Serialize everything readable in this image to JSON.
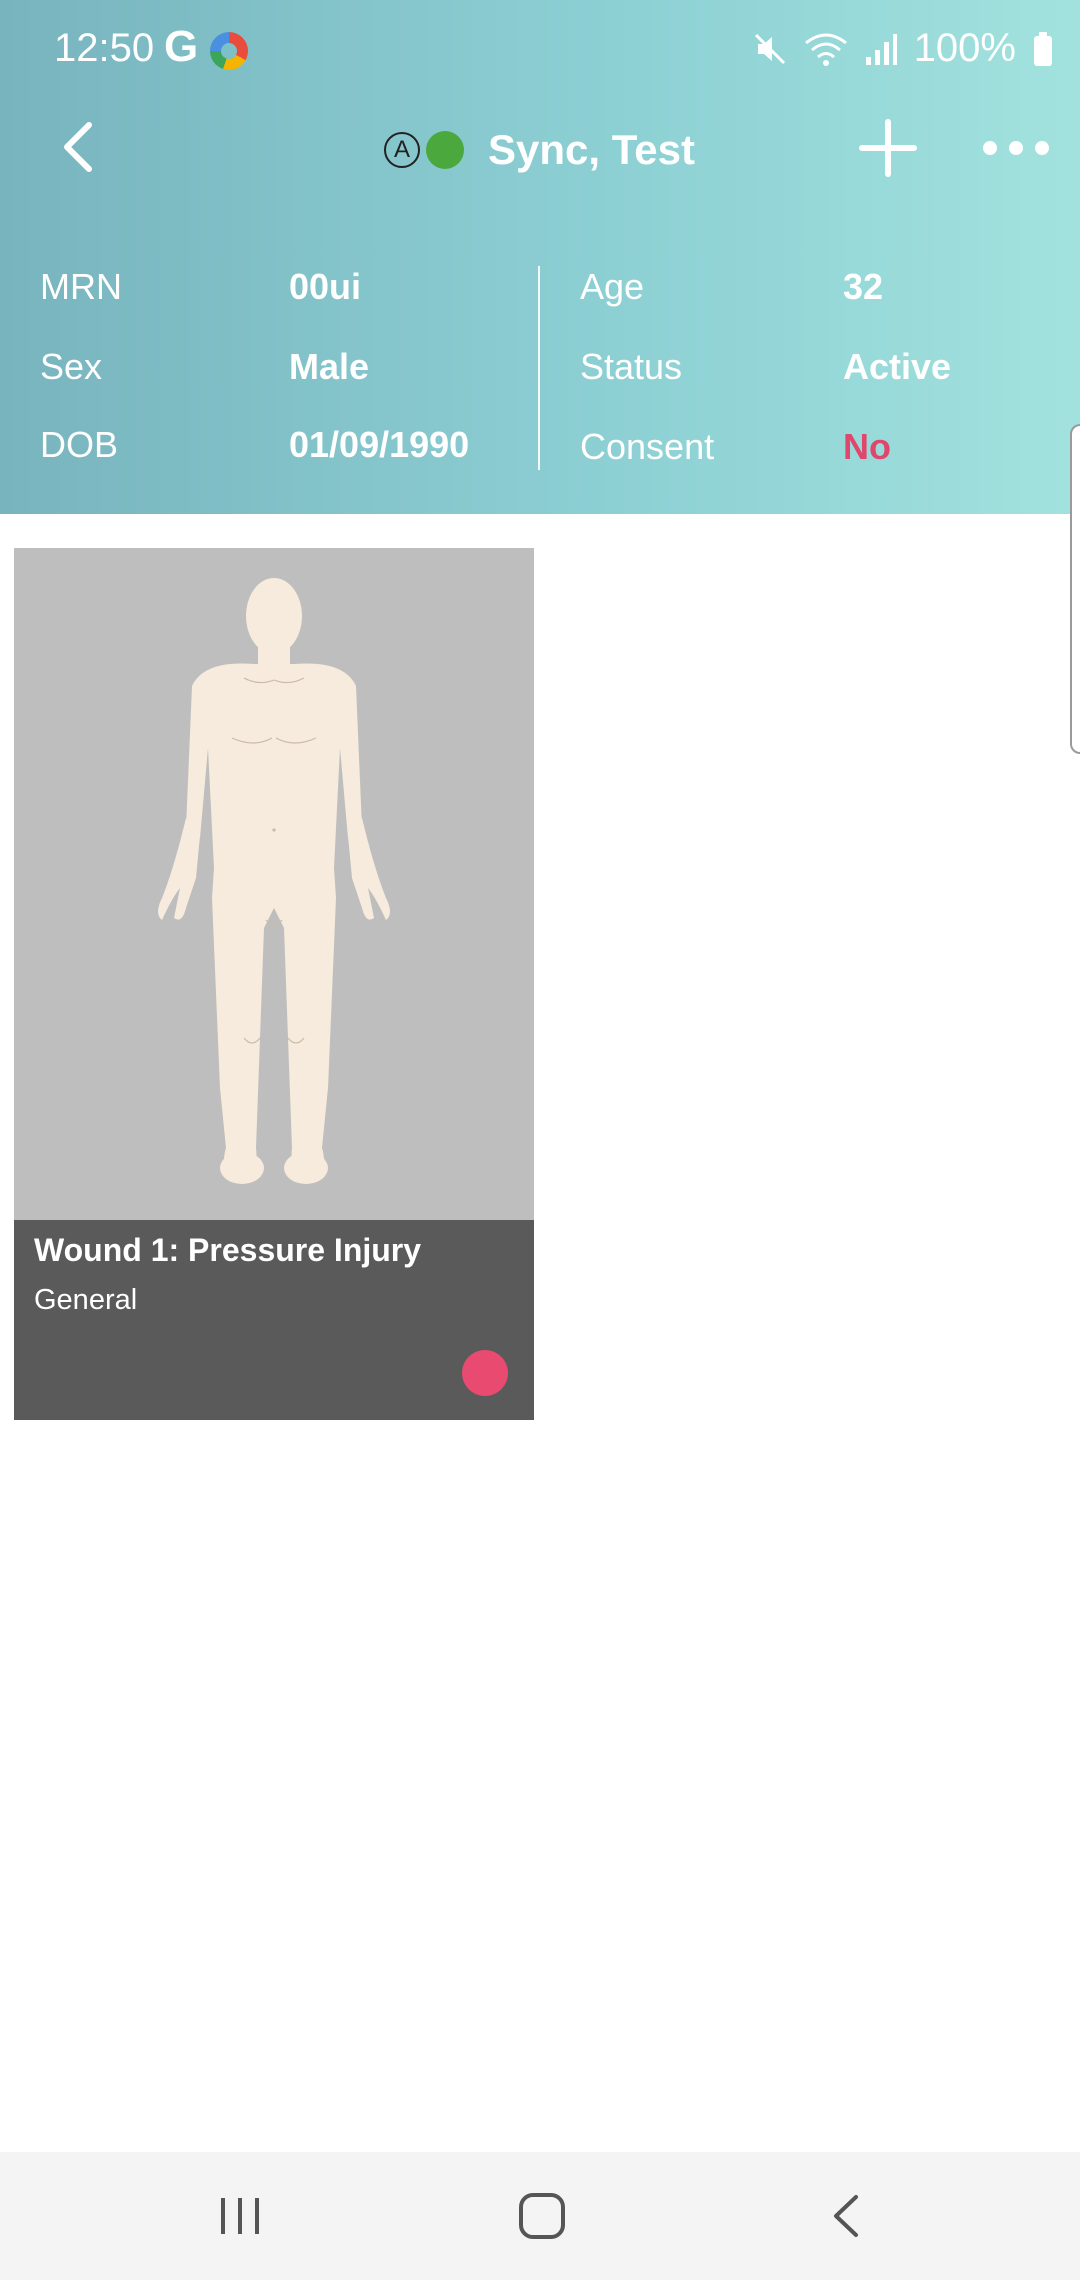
{
  "status_bar": {
    "time": "12:50",
    "g_label": "G",
    "battery": "100%",
    "icons": [
      "google-g-icon",
      "chrome-icon",
      "mute-icon",
      "wifi-icon",
      "signal-icon",
      "battery-icon"
    ]
  },
  "app_bar": {
    "title": "Sync, Test",
    "a_badge": "A",
    "status_color": "#4aa83c",
    "icons": [
      "back-icon",
      "add-icon",
      "more-icon"
    ]
  },
  "patient": {
    "left": [
      {
        "label": "MRN",
        "value": "00ui"
      },
      {
        "label": "Sex",
        "value": "Male"
      },
      {
        "label": "DOB",
        "value": "01/09/1990"
      }
    ],
    "right": [
      {
        "label": "Age",
        "value": "32"
      },
      {
        "label": "Status",
        "value": "Active"
      },
      {
        "label": "Consent",
        "value": "No"
      }
    ],
    "consent_color": "#e0476c"
  },
  "wound_card": {
    "title": "Wound 1: Pressure Injury",
    "subtitle": "General",
    "indicator_color": "#e84a70"
  },
  "nav_bar": {
    "icons": [
      "recent-apps-icon",
      "home-icon",
      "back-nav-icon"
    ]
  },
  "colors": {
    "header_start": "#78b4be",
    "header_end": "#a2e2de",
    "card_bg": "#bebebe",
    "card_footer": "#5a5a5a"
  }
}
